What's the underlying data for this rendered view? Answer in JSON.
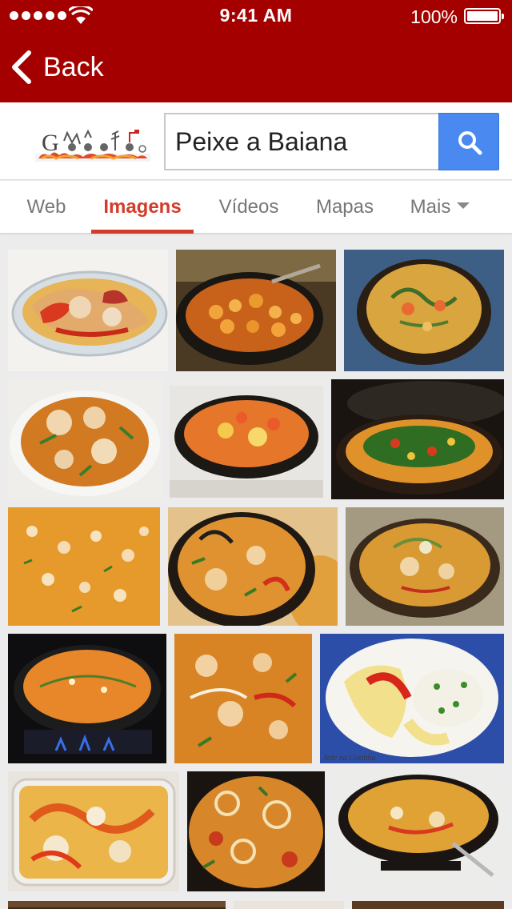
{
  "status_bar": {
    "time": "9:41 AM",
    "battery": "100%",
    "signal_icon": "signal-dots-icon",
    "wifi_icon": "wifi-icon",
    "battery_icon": "battery-icon"
  },
  "nav": {
    "back_label": "Back",
    "back_icon": "chevron-left-icon",
    "bar_color": "#a50000"
  },
  "search": {
    "query": "Peixe a Baiana",
    "button_icon": "search-icon",
    "button_color": "#4a89f0",
    "logo_icon": "google-doodle-logo"
  },
  "tabs": [
    {
      "label": "Web",
      "active": false
    },
    {
      "label": "Imagens",
      "active": true
    },
    {
      "label": "Vídeos",
      "active": false
    },
    {
      "label": "Mapas",
      "active": false
    },
    {
      "label": "Mais",
      "active": false,
      "dropdown": true
    }
  ],
  "accent_color": "#d23c2b",
  "results": {
    "watermark": "Arte na Cozinha"
  }
}
